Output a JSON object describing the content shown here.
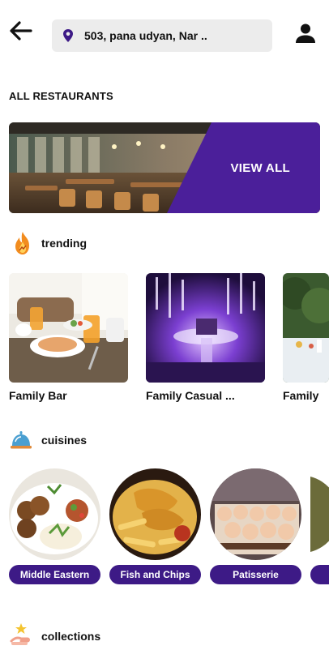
{
  "header": {
    "back_icon": "arrow-left-icon",
    "location_icon": "location-pin-icon",
    "location_text": "503, pana udyan, Nar ..",
    "profile_icon": "person-icon"
  },
  "all_restaurants": {
    "title": "ALL RESTAURANTS",
    "banner_cta": "VIEW ALL"
  },
  "trending": {
    "icon": "flame-icon",
    "title": "trending",
    "cards": [
      {
        "label": "Family Bar"
      },
      {
        "label": "Family Casual ..."
      },
      {
        "label": "Family"
      }
    ]
  },
  "cuisines": {
    "icon": "chef-cloche-icon",
    "title": "cuisines",
    "items": [
      {
        "label": "Middle Eastern"
      },
      {
        "label": "Fish and Chips"
      },
      {
        "label": "Patisserie"
      },
      {
        "label": ""
      }
    ]
  },
  "collections": {
    "icon": "collection-hand-icon",
    "title": "collections"
  },
  "colors": {
    "brand_purple": "#3d1a86",
    "search_bg": "#ececec"
  }
}
